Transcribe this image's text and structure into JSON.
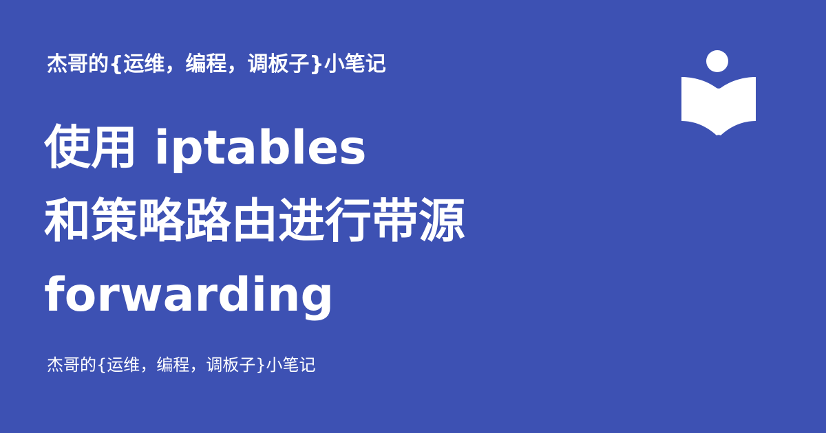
{
  "site": {
    "name_top": "杰哥的{运维，编程，调板子}小笔记",
    "name_bottom": "杰哥的{运维，编程，调板子}小笔记"
  },
  "post": {
    "title_lines": [
      "使用 iptables",
      "和策略路由进行带源",
      "forwarding"
    ]
  },
  "icons": {
    "logo": "reading-book-icon"
  },
  "colors": {
    "background": "#3d51b3",
    "text": "#ffffff"
  }
}
